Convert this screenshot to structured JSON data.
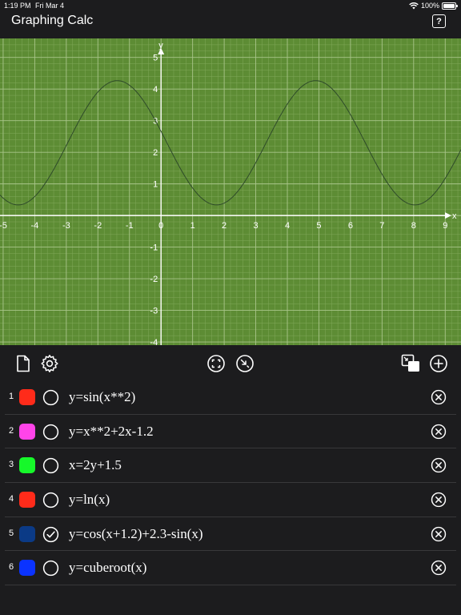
{
  "status": {
    "time": "1:19 PM",
    "date": "Fri Mar 4",
    "battery": "100%",
    "battery_level": 1.0
  },
  "app": {
    "title": "Graphing Calc",
    "help_label": "?"
  },
  "graph": {
    "colors": {
      "background": "#5d8c34",
      "grid_minor": "#80a85a",
      "grid_major": "#a9c58a",
      "axis": "#ffffff",
      "curve": "#2e4a2a"
    },
    "x_axis_label": "x",
    "y_axis_label": "y",
    "x_ticks": [
      "-5",
      "-4",
      "-3",
      "-2",
      "-1",
      "0",
      "1",
      "2",
      "3",
      "4",
      "5",
      "6",
      "7",
      "8",
      "9"
    ],
    "y_ticks": [
      "5",
      "4",
      "3",
      "2",
      "1",
      "-1",
      "-2",
      "-3",
      "-4"
    ],
    "plotted_function": "y=cos(x+1.2)+2.3-sin(x)",
    "xlim": [
      -5.1,
      9.5
    ],
    "ylim": [
      -4.1,
      5.6
    ]
  },
  "toolbar": {
    "left": [
      "document-icon",
      "gear-icon"
    ],
    "center": [
      "focus-icon",
      "zoom-in-icon"
    ],
    "right": [
      "windows-icon",
      "add-icon"
    ]
  },
  "equations": [
    {
      "index": "1",
      "color": "#ff2b1a",
      "checked": false,
      "text": "y=sin(x**2)"
    },
    {
      "index": "2",
      "color": "#ff44e9",
      "checked": false,
      "text": "y=x**2+2x-1.2"
    },
    {
      "index": "3",
      "color": "#16f82a",
      "checked": false,
      "text": "x=2y+1.5"
    },
    {
      "index": "4",
      "color": "#ff2b1a",
      "checked": false,
      "text": "y=ln(x)"
    },
    {
      "index": "5",
      "color": "#0b3a86",
      "checked": true,
      "text": "y=cos(x+1.2)+2.3-sin(x)"
    },
    {
      "index": "6",
      "color": "#0b33ff",
      "checked": false,
      "text": "y=cuberoot(x)"
    }
  ]
}
